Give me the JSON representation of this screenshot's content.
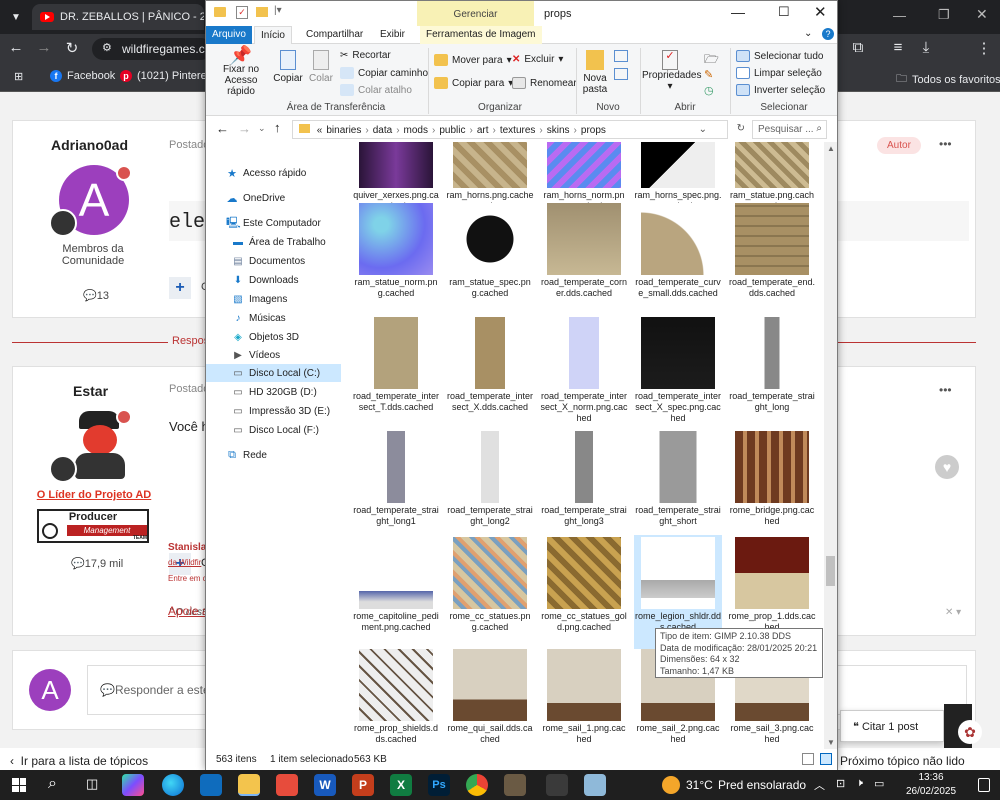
{
  "browser": {
    "tab_label": "DR. ZEBALLOS | PÂNICO - 2",
    "url": "wildfiregames.co",
    "bookmarks": [
      "Facebook",
      "(1021) Pinterest"
    ],
    "all_favorites": "Todos os favoritos"
  },
  "forum": {
    "post1": {
      "author": "Adriano0ad",
      "posted": "Postado",
      "avatar_letter": "A",
      "role": "Membros da Comunidade",
      "posts": "13",
      "badge": "Autor",
      "body": "ele",
      "more": "•••"
    },
    "reply_divider": "Respost",
    "post2": {
      "author": "Estar",
      "posted": "Postado",
      "rank": "O Líder do Projeto AD",
      "producer_line1": "Producer",
      "producer_line2": "Management",
      "producer_line3": "TEAM",
      "posts": "17,9 mil",
      "body": "Você ha",
      "quote": "\" O dest",
      "sig_name": "Stanisla",
      "sig_link": "da Wildfir",
      "sig_text": "Entre em c",
      "support": "Apoie a",
      "more": "•••"
    },
    "reply_placeholder": "Responder a este t",
    "reply_avatar_letter": "A",
    "quote_button": "Citar 1 post",
    "back_link": "Ir para a lista de tópicos",
    "next_topic": "Próximo tópico não lido"
  },
  "explorer": {
    "title": "props",
    "context_tab": "Gerenciar",
    "tabs": [
      "Arquivo",
      "Início",
      "Compartilhar",
      "Exibir",
      "Ferramentas de Imagem"
    ],
    "ribbon": {
      "pin": "Fixar no Acesso rápido",
      "copy": "Copiar",
      "paste": "Colar",
      "cut": "Recortar",
      "copy_path": "Copiar caminho",
      "paste_shortcut": "Colar atalho",
      "clipboard_group": "Área de Transferência",
      "move_to": "Mover para",
      "copy_to": "Copiar para",
      "delete": "Excluir",
      "rename": "Renomear",
      "organize_group": "Organizar",
      "new_folder": "Nova pasta",
      "new_group": "Novo",
      "properties": "Propriedades",
      "open_group": "Abrir",
      "select_all": "Selecionar tudo",
      "clear_selection": "Limpar seleção",
      "invert_selection": "Inverter seleção",
      "select_group": "Selecionar"
    },
    "breadcrumb": [
      "«",
      "binaries",
      "data",
      "mods",
      "public",
      "art",
      "textures",
      "skins",
      "props"
    ],
    "search_placeholder": "Pesquisar ...",
    "nav": [
      {
        "label": "Acesso rápido",
        "icon": "star-icon",
        "indent": 0
      },
      {
        "label": "OneDrive",
        "icon": "cloud-icon",
        "indent": 0
      },
      {
        "label": "Este Computador",
        "icon": "computer-icon",
        "indent": 0
      },
      {
        "label": "Área de Trabalho",
        "icon": "desktop-icon",
        "indent": 1
      },
      {
        "label": "Documentos",
        "icon": "documents-icon",
        "indent": 1
      },
      {
        "label": "Downloads",
        "icon": "downloads-icon",
        "indent": 1
      },
      {
        "label": "Imagens",
        "icon": "images-icon",
        "indent": 1
      },
      {
        "label": "Músicas",
        "icon": "music-icon",
        "indent": 1
      },
      {
        "label": "Objetos 3D",
        "icon": "objects3d-icon",
        "indent": 1
      },
      {
        "label": "Vídeos",
        "icon": "videos-icon",
        "indent": 1
      },
      {
        "label": "Disco Local (C:)",
        "icon": "drive-icon",
        "indent": 1,
        "selected": true
      },
      {
        "label": "HD 320GB (D:)",
        "icon": "drive-icon",
        "indent": 1
      },
      {
        "label": "Impressão 3D (E:)",
        "icon": "drive-icon",
        "indent": 1
      },
      {
        "label": "Disco Local (F:)",
        "icon": "drive-icon",
        "indent": 1
      },
      {
        "label": "Rede",
        "icon": "network-icon",
        "indent": 0
      }
    ],
    "files": [
      [
        "quiver_xerxes.png.cached",
        "ram_horns.png.cached",
        "ram_horns_norm.png.cached",
        "ram_horns_spec.png.cached",
        "ram_statue.png.cached"
      ],
      [
        "ram_statue_norm.png.cached",
        "ram_statue_spec.png.cached",
        "road_temperate_corner.dds.cached",
        "road_temperate_curve_small.dds.cached",
        "road_temperate_end.dds.cached"
      ],
      [
        "road_temperate_intersect_T.dds.cached",
        "road_temperate_intersect_X.dds.cached",
        "road_temperate_intersect_X_norm.png.cached",
        "road_temperate_intersect_X_spec.png.cached",
        "road_temperate_straight_long"
      ],
      [
        "road_temperate_straight_long1",
        "road_temperate_straight_long2",
        "road_temperate_straight_long3",
        "road_temperate_straight_short",
        "rome_bridge.png.cached"
      ],
      [
        "rome_capitoline_pediment.png.cached",
        "rome_cc_statues.png.cached",
        "rome_cc_statues_gold.png.cached",
        "rome_legion_shldr.dds.cached",
        "rome_prop_1.dds.cached"
      ],
      [
        "rome_prop_shields.dds.cached",
        "rome_qui_sail.dds.cached",
        "rome_sail_1.png.cached",
        "rome_sail_2.png.cached",
        "rome_sail_3.png.cached"
      ]
    ],
    "selected_file": "rome_legion_shldr.dds.cached",
    "tooltip": [
      "Tipo de item: GIMP 2.10.38 DDS",
      "Data de modificação: 28/01/2025 20:21",
      "Dimensões: 64 x 32",
      "Tamanho: 1,47 KB"
    ],
    "status": {
      "count": "563 itens",
      "selected": "1 item selecionado",
      "size": "563 KB"
    }
  },
  "taskbar": {
    "temperature": "31°C",
    "weather": "Pred ensolarado",
    "time": "13:36",
    "date": "26/02/2025"
  },
  "colors": {
    "accent": "#0067c0",
    "selection": "#cce8ff",
    "avatar": "#9c3fbd",
    "author_badge": "#d9534f"
  }
}
